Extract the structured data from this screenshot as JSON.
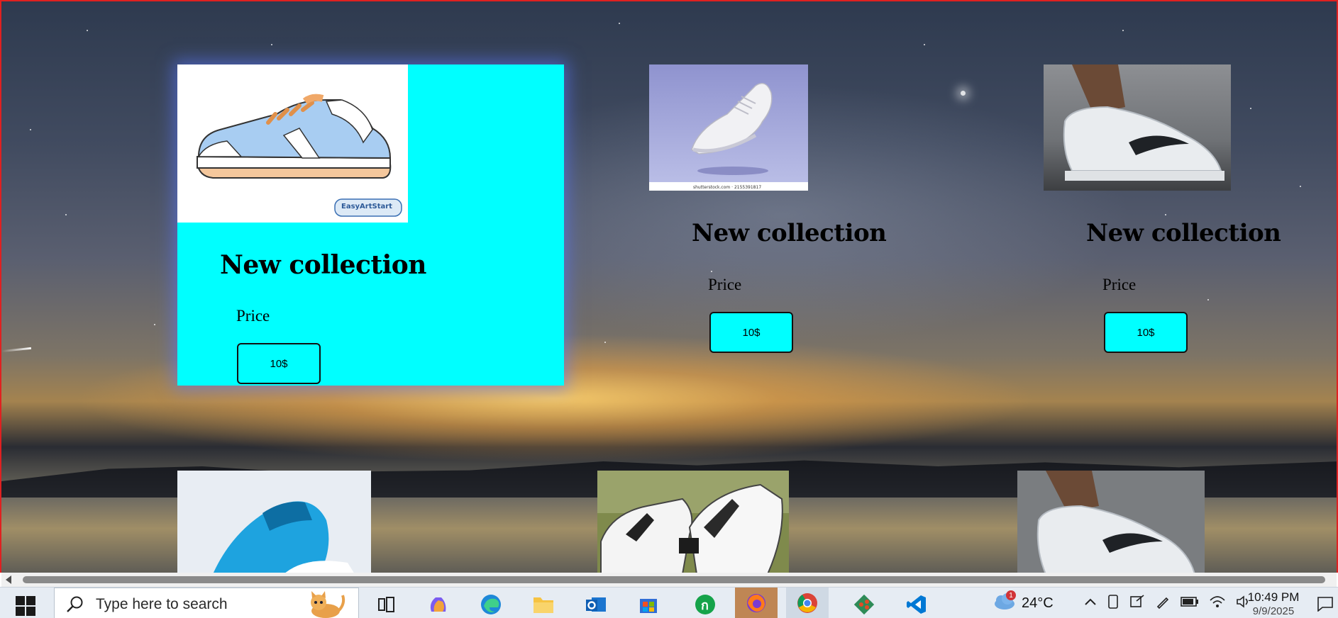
{
  "products": [
    {
      "title": "New collection",
      "price_label": "Price",
      "button_label": "10$"
    },
    {
      "title": "New collection",
      "price_label": "Price",
      "button_label": "10$"
    },
    {
      "title": "New collection",
      "price_label": "Price",
      "button_label": "10$"
    }
  ],
  "product_image_credits": {
    "card1": "EasyArtStart",
    "card2": "shutterstock.com · 2155391817"
  },
  "taskbar": {
    "search_placeholder": "Type here to search",
    "weather_temp": "24°C",
    "notification_count": "1",
    "time": "10:49 PM",
    "date": "9/9/2025"
  },
  "colors": {
    "card_accent": "#00ffff",
    "button_bg": "#00ffff",
    "page_border": "#e02020"
  },
  "icons": [
    "windows-start-icon",
    "search-icon",
    "cat-icon",
    "task-view-icon",
    "copilot-icon",
    "edge-icon",
    "file-explorer-icon",
    "outlook-icon",
    "microsoft-store-icon",
    "app-icon",
    "firefox-icon",
    "chrome-icon",
    "git-icon",
    "vscode-icon",
    "weather-cloud-icon"
  ]
}
